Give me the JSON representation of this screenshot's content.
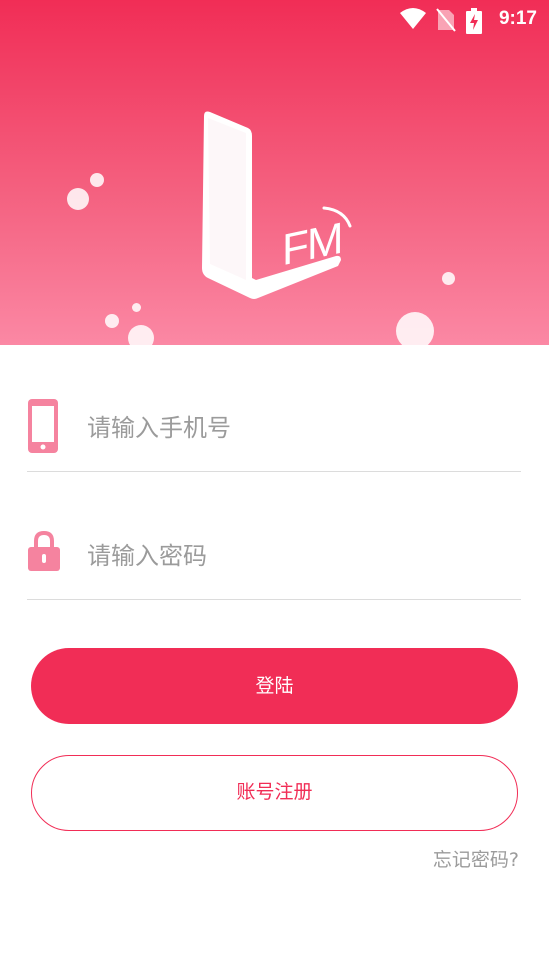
{
  "status_bar": {
    "time": "9:17",
    "icons": [
      "wifi-icon",
      "no-sim-icon",
      "battery-charging-icon"
    ]
  },
  "brand": {
    "logo_text": "FM",
    "colors": {
      "primary": "#f12d56",
      "gradient_end": "#fb88a4",
      "hint": "#9b9b9b"
    }
  },
  "form": {
    "phone": {
      "placeholder": "请输入手机号",
      "value": "",
      "icon": "phone-icon"
    },
    "password": {
      "placeholder": "请输入密码",
      "value": "",
      "icon": "lock-icon"
    }
  },
  "actions": {
    "login_label": "登陆",
    "register_label": "账号注册",
    "forgot_label": "忘记密码?"
  }
}
